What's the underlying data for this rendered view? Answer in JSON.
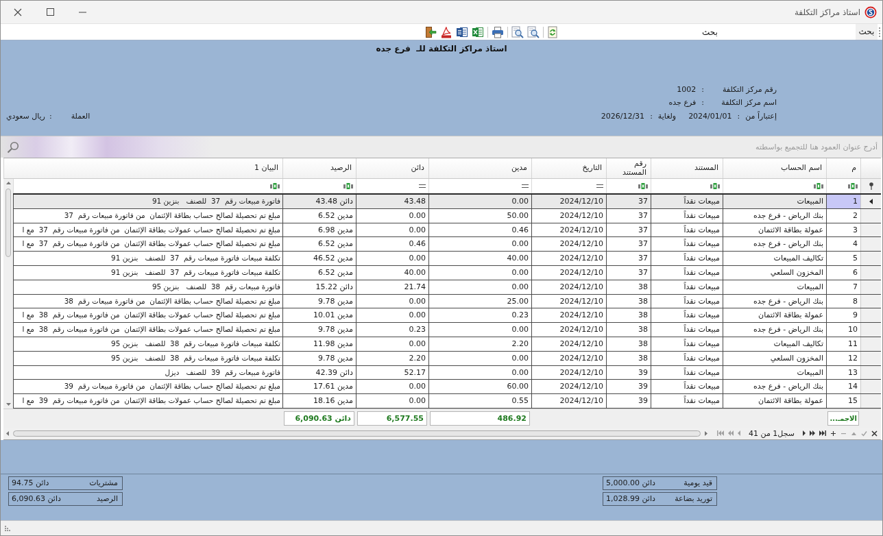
{
  "window": {
    "title": "استاذ مراكز التكلفة"
  },
  "toolbar": {
    "search_label": "بحث",
    "search": {
      "value": "بحث"
    }
  },
  "report": {
    "title": "استاذ مراكز التكلفة للـ  فرع جده",
    "info": [
      {
        "label": "رقم مركز التكلفة",
        "colon": ":",
        "value": "1002"
      },
      {
        "label": "اسم مركز التكلفة",
        "colon": ":",
        "value": "فرع جده"
      }
    ],
    "period": {
      "from_label": "إعتباراً من",
      "from_colon": ":",
      "from": "2024/01/01",
      "to_label": "ولغاية",
      "to_colon": ":",
      "to": "2026/12/31"
    },
    "currency": {
      "label": "العملة",
      "colon": ":",
      "value": "ريال سعودي"
    }
  },
  "table": {
    "group_hint": "أدرج عنوان العمود هنا للتجميع بواسطته",
    "columns": [
      {
        "label": "م",
        "kind": "text"
      },
      {
        "label": "اسم الحساب",
        "kind": "text"
      },
      {
        "label": "المستند",
        "kind": "text"
      },
      {
        "label": "رقم المستند",
        "kind": "text"
      },
      {
        "label": "التاريخ",
        "kind": "equals"
      },
      {
        "label": "مدين",
        "kind": "equals"
      },
      {
        "label": "دائن",
        "kind": "equals"
      },
      {
        "label": "الرصيد",
        "kind": "text"
      },
      {
        "label": "البيان 1",
        "kind": "text"
      }
    ],
    "rows": [
      {
        "selected": true,
        "cells": [
          "1",
          "المبيعات",
          "مبيعات نقداً",
          "37",
          "2024/12/10",
          "0.00",
          "43.48",
          "43.48 دائن",
          "فاتورة مبيعات رقم  37  للصنف   بنزين 91"
        ]
      },
      {
        "selected": false,
        "cells": [
          "2",
          "بنك الرياض - فرع جده",
          "مبيعات نقداً",
          "37",
          "2024/12/10",
          "50.00",
          "0.00",
          "6.52 مدين",
          "مبلغ تم تحصيلة لصالح حساب بطاقة الإئتمان  من فاتورة مبيعات رقم  37"
        ]
      },
      {
        "selected": false,
        "cells": [
          "3",
          "عمولة بطاقة الائتمان",
          "مبيعات نقداً",
          "37",
          "2024/12/10",
          "0.46",
          "0.00",
          "6.98 مدين",
          "مبلغ تم تحصيلة لصالح حساب عمولات بطاقة الإئتمان  من فاتورة مبيعات رقم  37  مع ا"
        ]
      },
      {
        "selected": false,
        "cells": [
          "4",
          "بنك الرياض - فرع جده",
          "مبيعات نقداً",
          "37",
          "2024/12/10",
          "0.00",
          "0.46",
          "6.52 مدين",
          "مبلغ تم تحصيلة لصالح حساب عمولات بطاقة الإئتمان  من فاتورة مبيعات رقم  37  مع ا"
        ]
      },
      {
        "selected": false,
        "cells": [
          "5",
          "تكاليف المبيعات",
          "مبيعات نقداً",
          "37",
          "2024/12/10",
          "40.00",
          "0.00",
          "46.52 مدين",
          "تكلفة مبيعات فاتورة مبيعات رقم  37  للصنف   بنزين 91"
        ]
      },
      {
        "selected": false,
        "cells": [
          "6",
          "المخزون السلعي",
          "مبيعات نقداً",
          "37",
          "2024/12/10",
          "0.00",
          "40.00",
          "6.52 مدين",
          "تكلفة مبيعات فاتورة مبيعات رقم  37  للصنف   بنزين 91"
        ]
      },
      {
        "selected": false,
        "cells": [
          "7",
          "المبيعات",
          "مبيعات نقداً",
          "38",
          "2024/12/10",
          "0.00",
          "21.74",
          "15.22 دائن",
          "فاتورة مبيعات رقم  38  للصنف   بنزين 95"
        ]
      },
      {
        "selected": false,
        "cells": [
          "8",
          "بنك الرياض - فرع جده",
          "مبيعات نقداً",
          "38",
          "2024/12/10",
          "25.00",
          "0.00",
          "9.78 مدين",
          "مبلغ تم تحصيلة لصالح حساب بطاقة الإئتمان  من فاتورة مبيعات رقم  38"
        ]
      },
      {
        "selected": false,
        "cells": [
          "9",
          "عمولة بطاقة الائتمان",
          "مبيعات نقداً",
          "38",
          "2024/12/10",
          "0.23",
          "0.00",
          "10.01 مدين",
          "مبلغ تم تحصيلة لصالح حساب عمولات بطاقة الإئتمان  من فاتورة مبيعات رقم  38  مع ا"
        ]
      },
      {
        "selected": false,
        "cells": [
          "10",
          "بنك الرياض - فرع جده",
          "مبيعات نقداً",
          "38",
          "2024/12/10",
          "0.00",
          "0.23",
          "9.78 مدين",
          "مبلغ تم تحصيلة لصالح حساب عمولات بطاقة الإئتمان  من فاتورة مبيعات رقم  38  مع ا"
        ]
      },
      {
        "selected": false,
        "cells": [
          "11",
          "تكاليف المبيعات",
          "مبيعات نقداً",
          "38",
          "2024/12/10",
          "2.20",
          "0.00",
          "11.98 مدين",
          "تكلفة مبيعات فاتورة مبيعات رقم  38  للصنف   بنزين 95"
        ]
      },
      {
        "selected": false,
        "cells": [
          "12",
          "المخزون السلعي",
          "مبيعات نقداً",
          "38",
          "2024/12/10",
          "0.00",
          "2.20",
          "9.78 مدين",
          "تكلفة مبيعات فاتورة مبيعات رقم  38  للصنف   بنزين 95"
        ]
      },
      {
        "selected": false,
        "cells": [
          "13",
          "المبيعات",
          "مبيعات نقداً",
          "39",
          "2024/12/10",
          "0.00",
          "52.17",
          "42.39 دائن",
          "فاتورة مبيعات رقم  39  للصنف   ديزل"
        ]
      },
      {
        "selected": false,
        "cells": [
          "14",
          "بنك الرياض - فرع جده",
          "مبيعات نقداً",
          "39",
          "2024/12/10",
          "60.00",
          "0.00",
          "17.61 مدين",
          "مبلغ تم تحصيلة لصالح حساب بطاقة الإئتمان  من فاتورة مبيعات رقم  39"
        ]
      },
      {
        "selected": false,
        "cells": [
          "15",
          "عمولة بطاقة الائتمان",
          "مبيعات نقداً",
          "39",
          "2024/12/10",
          "0.55",
          "0.00",
          "18.16 مدين",
          "مبلغ تم تحصيلة لصالح حساب عمولات بطاقة الإئتمان  من فاتورة مبيعات رقم  39  مع ا"
        ]
      }
    ],
    "footer": {
      "label": "الاجمـ...",
      "debit": "486.92",
      "credit": "6,577.55",
      "balance": "6,090.63 دائن"
    }
  },
  "navigator": {
    "buttons_right": [
      {
        "kind": "cancel",
        "disabled": false
      },
      {
        "kind": "accept",
        "disabled": true
      },
      {
        "kind": "edit",
        "disabled": true
      },
      {
        "kind": "remove",
        "disabled": true
      },
      {
        "kind": "add",
        "disabled": false
      },
      {
        "kind": "last",
        "disabled": false
      },
      {
        "kind": "next_page",
        "disabled": false
      },
      {
        "kind": "next",
        "disabled": false
      }
    ],
    "record_text": "سجل1 من 41",
    "buttons_left": [
      {
        "kind": "prev",
        "disabled": true
      },
      {
        "kind": "prev_page",
        "disabled": true
      },
      {
        "kind": "first",
        "disabled": true
      }
    ]
  },
  "summary": {
    "right": [
      {
        "label": "قيد يومية",
        "value": "5,000.00 دائن"
      },
      {
        "label": "توريد بضاعة",
        "value": "1,028.99 دائن"
      }
    ],
    "left": [
      {
        "label": "مشتريات",
        "value": "94.75 دائن"
      },
      {
        "label": "الرصيد",
        "value": "6,090.63 دائن"
      }
    ]
  }
}
